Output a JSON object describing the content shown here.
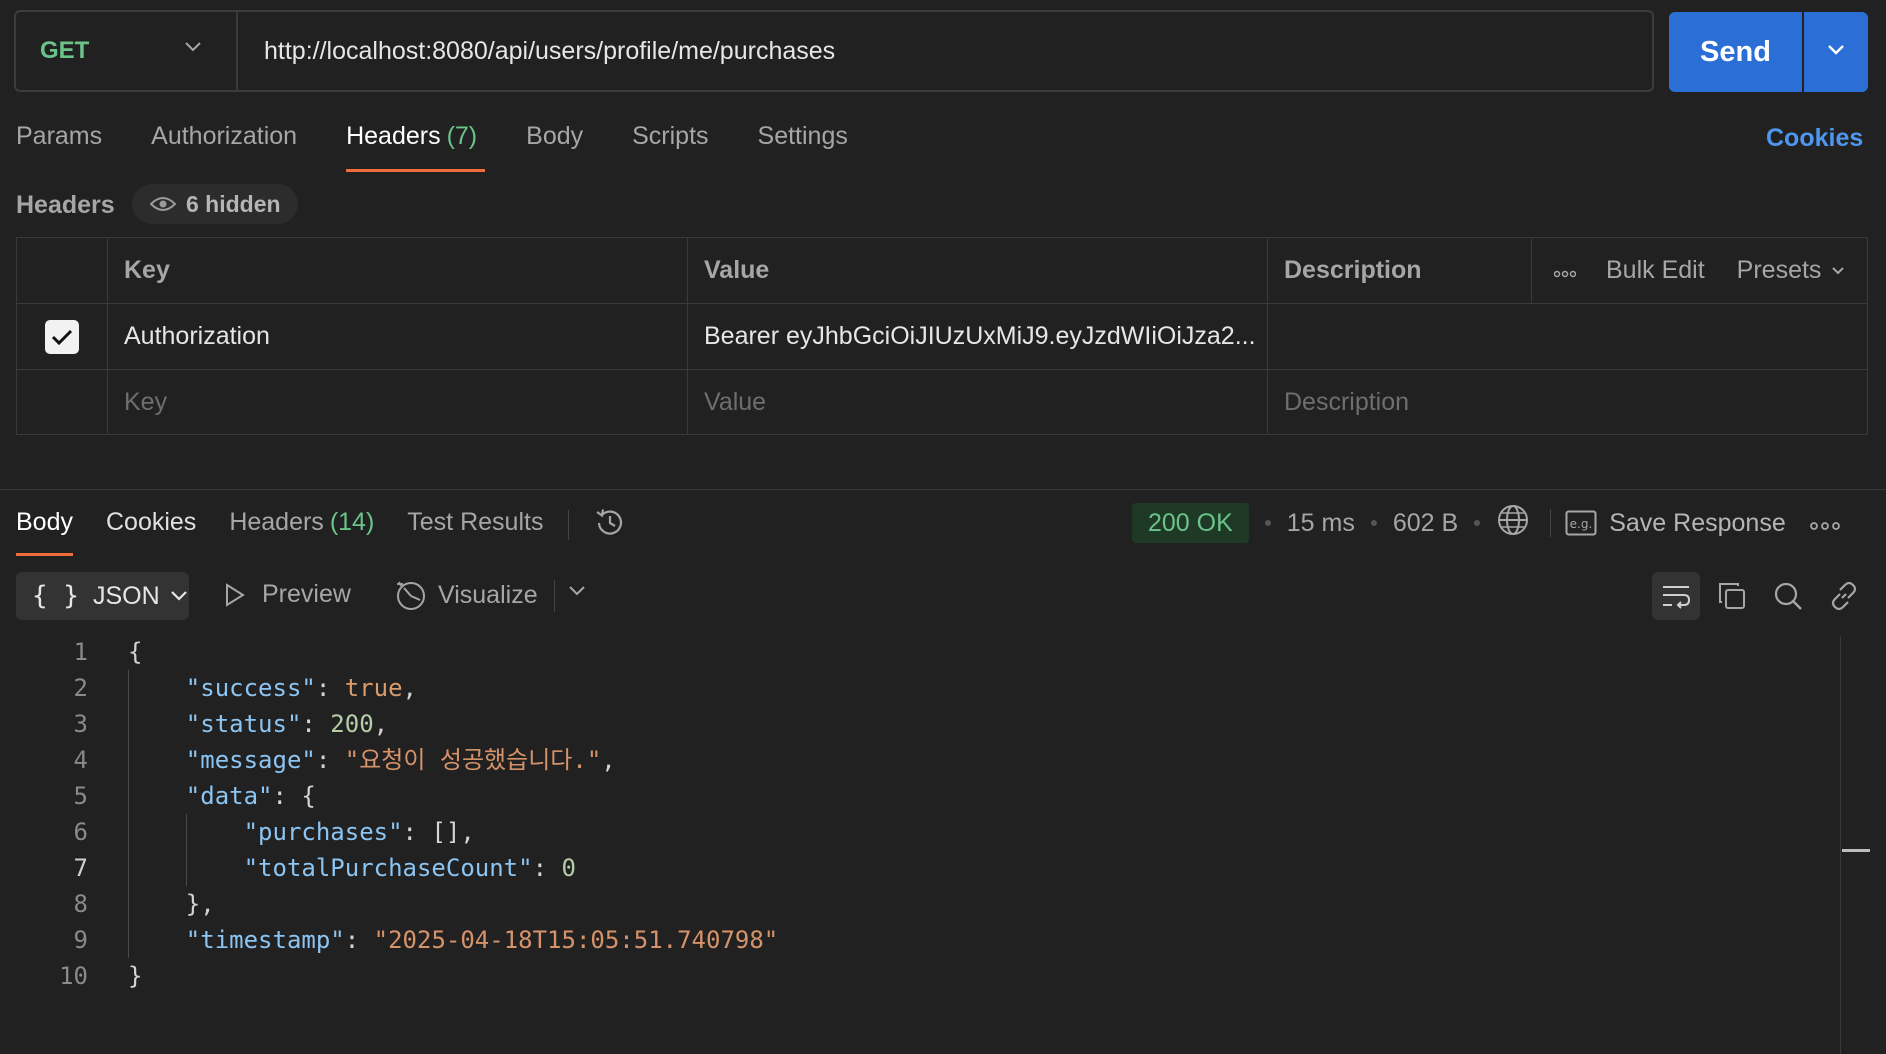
{
  "request": {
    "method": "GET",
    "url": "http://localhost:8080/api/users/profile/me/purchases",
    "send_label": "Send"
  },
  "request_tabs": [
    {
      "label": "Params"
    },
    {
      "label": "Authorization"
    },
    {
      "label": "Headers",
      "count": "(7)"
    },
    {
      "label": "Body"
    },
    {
      "label": "Scripts"
    },
    {
      "label": "Settings"
    }
  ],
  "cookies_label": "Cookies",
  "headers_section": {
    "title": "Headers",
    "hidden_label": "6 hidden",
    "columns": {
      "key": "Key",
      "value": "Value",
      "description": "Description"
    },
    "actions": {
      "bulk_edit": "Bulk Edit",
      "presets": "Presets"
    },
    "rows": [
      {
        "checked": true,
        "key": "Authorization",
        "value": "Bearer eyJhbGciOiJIUzUxMiJ9.eyJzdWIiOiJza2..."
      }
    ],
    "placeholders": {
      "key": "Key",
      "value": "Value",
      "description": "Description"
    }
  },
  "response_tabs": [
    {
      "label": "Body"
    },
    {
      "label": "Cookies"
    },
    {
      "label": "Headers",
      "count": "(14)"
    },
    {
      "label": "Test Results"
    }
  ],
  "response_meta": {
    "status": "200 OK",
    "time": "15 ms",
    "size": "602 B",
    "save_label": "Save Response",
    "status_color": "#6cc38a"
  },
  "response_toolbar": {
    "format": "JSON",
    "preview": "Preview",
    "visualize": "Visualize"
  },
  "code_lines": [
    {
      "num": "1",
      "indent": "",
      "parts": [
        {
          "c": "p",
          "t": "{"
        }
      ]
    },
    {
      "num": "2",
      "indent": "    ",
      "parts": [
        {
          "c": "k",
          "t": "\"success\""
        },
        {
          "c": "p",
          "t": ": "
        },
        {
          "c": "b",
          "t": "true"
        },
        {
          "c": "p",
          "t": ","
        }
      ]
    },
    {
      "num": "3",
      "indent": "    ",
      "parts": [
        {
          "c": "k",
          "t": "\"status\""
        },
        {
          "c": "p",
          "t": ": "
        },
        {
          "c": "n",
          "t": "200"
        },
        {
          "c": "p",
          "t": ","
        }
      ]
    },
    {
      "num": "4",
      "indent": "    ",
      "parts": [
        {
          "c": "k",
          "t": "\"message\""
        },
        {
          "c": "p",
          "t": ": "
        },
        {
          "c": "s",
          "t": "\"요청이 성공했습니다.\""
        },
        {
          "c": "p",
          "t": ","
        }
      ]
    },
    {
      "num": "5",
      "indent": "    ",
      "parts": [
        {
          "c": "k",
          "t": "\"data\""
        },
        {
          "c": "p",
          "t": ": {"
        }
      ]
    },
    {
      "num": "6",
      "indent": "        ",
      "parts": [
        {
          "c": "k",
          "t": "\"purchases\""
        },
        {
          "c": "p",
          "t": ": [],"
        }
      ]
    },
    {
      "num": "7",
      "indent": "        ",
      "parts": [
        {
          "c": "k",
          "t": "\"totalPurchaseCount\""
        },
        {
          "c": "p",
          "t": ": "
        },
        {
          "c": "n",
          "t": "0"
        }
      ]
    },
    {
      "num": "8",
      "indent": "    ",
      "parts": [
        {
          "c": "p",
          "t": "},"
        }
      ]
    },
    {
      "num": "9",
      "indent": "    ",
      "parts": [
        {
          "c": "k",
          "t": "\"timestamp\""
        },
        {
          "c": "p",
          "t": ": "
        },
        {
          "c": "s",
          "t": "\"2025-04-18T15:05:51.740798\""
        }
      ]
    },
    {
      "num": "10",
      "indent": "",
      "parts": [
        {
          "c": "p",
          "t": "}"
        }
      ]
    }
  ],
  "current_line": "7"
}
